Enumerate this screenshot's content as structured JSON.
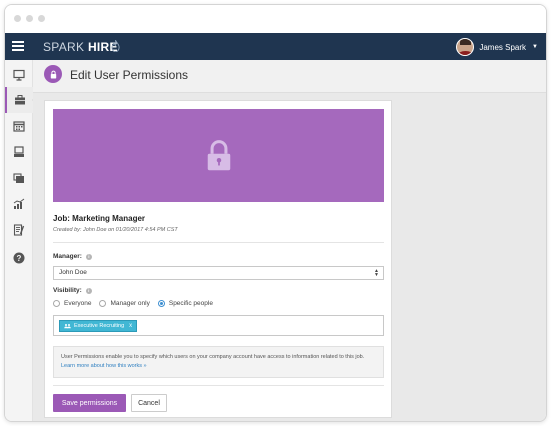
{
  "brand": {
    "word1": "SPARK",
    "word2": "HIRE"
  },
  "user": {
    "name": "James Spark"
  },
  "sidebar": {
    "items": [
      {
        "icon": "presentation-icon"
      },
      {
        "icon": "briefcase-icon",
        "active": true
      },
      {
        "icon": "calendar-icon"
      },
      {
        "icon": "monitor-icon"
      },
      {
        "icon": "folders-icon"
      },
      {
        "icon": "bar-chart-icon"
      },
      {
        "icon": "edit-list-icon"
      },
      {
        "icon": "help-circle-icon"
      }
    ]
  },
  "page": {
    "title": "Edit User Permissions"
  },
  "job": {
    "title": "Job: Marketing Manager",
    "meta": "Created by: John Doe on 01/20/2017 4:54 PM CST"
  },
  "form": {
    "manager_label": "Manager:",
    "manager_help": "i",
    "manager_value": "John Doe",
    "visibility_label": "Visibility:",
    "visibility_help": "i",
    "visibility_options": [
      "Everyone",
      "Manager only",
      "Specific people"
    ],
    "visibility_selected": "Specific people",
    "tag_label": "Executive Recruiting",
    "tag_remove": "x",
    "info_text": "User Permissions enable you to specify which users on your company account have access to information related to this job.",
    "info_link": "Learn more about how this works »",
    "save_label": "Save permissions",
    "cancel_label": "Cancel"
  },
  "colors": {
    "accent": "#9b59b6",
    "banner": "#a569bd",
    "nav": "#1f3550",
    "tag": "#41b7d4",
    "link": "#2e7fc0"
  }
}
